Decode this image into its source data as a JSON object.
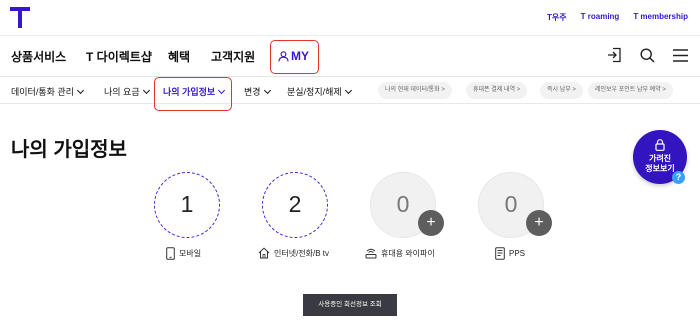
{
  "header": {
    "logo": "T",
    "links": [
      "T우주",
      "T roaming",
      "T membership"
    ]
  },
  "mainnav": {
    "items": [
      "상품서비스",
      "T 다이렉트샵",
      "혜택",
      "고객지원"
    ],
    "my_label": "MY"
  },
  "subnav": {
    "items": [
      "데이터/통화 관리",
      "나의 요금",
      "나의 가입정보",
      "변경",
      "분실/정지/해제"
    ],
    "active_index": 2,
    "quick_links": [
      "나의 현재 데이터/통화 >",
      "휴대폰 결제 내역 >",
      "즉시 납부 >",
      "레인보우 포인트 납부 예약 >"
    ]
  },
  "page": {
    "title": "나의 가입정보"
  },
  "services": [
    {
      "label": "모바일",
      "count": "1",
      "active": true,
      "icon": "mobile-icon"
    },
    {
      "label": "인터넷/전화/B tv",
      "count": "2",
      "active": true,
      "icon": "home-icon"
    },
    {
      "label": "휴대용 와이파이",
      "count": "0",
      "active": false,
      "icon": "wifi-router-icon"
    },
    {
      "label": "PPS",
      "count": "0",
      "active": false,
      "icon": "pps-icon"
    }
  ],
  "actions": {
    "lines_button": "사용중인 회선정보 조회",
    "float_button": [
      "가려진",
      "정보보기"
    ],
    "help": "?"
  },
  "colors": {
    "brand": "#3617ce",
    "highlight": "#e3342f",
    "dark_button": "#3a3a42",
    "help_blue": "#3aa0f5"
  }
}
